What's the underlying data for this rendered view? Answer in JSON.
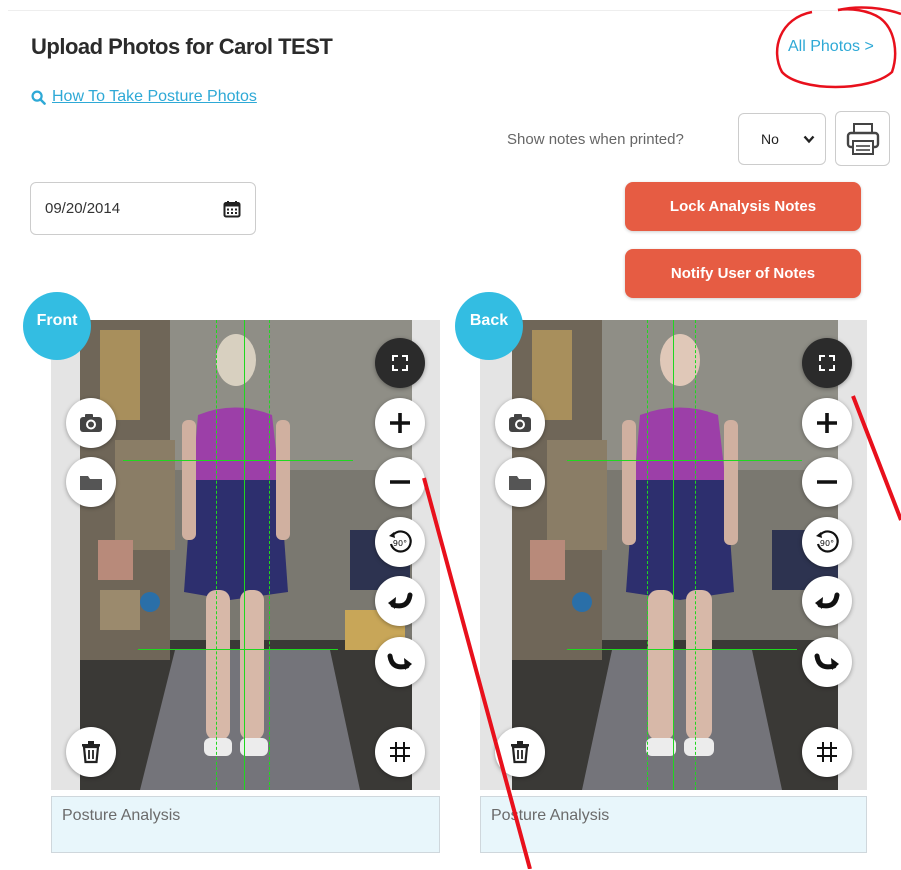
{
  "header": {
    "title": "Upload Photos for Carol TEST",
    "all_photos_link": "All Photos >",
    "how_to_link": "How To Take Posture Photos"
  },
  "print_options": {
    "notes_label": "Show notes when printed?",
    "notes_selected": "No"
  },
  "date_field": {
    "value": "09/20/2014"
  },
  "buttons": {
    "lock_notes": "Lock Analysis Notes",
    "notify_user": "Notify User of Notes"
  },
  "panels": [
    {
      "label": "Front",
      "notes_placeholder": "Posture Analysis"
    },
    {
      "label": "Back",
      "notes_placeholder": "Posture Analysis"
    }
  ],
  "colors": {
    "accent_blue": "#33bde2",
    "link_blue": "#2ea9d6",
    "button_orange": "#e65c43",
    "guide_green": "#1fd81f",
    "annotation_red": "#e8101c"
  }
}
